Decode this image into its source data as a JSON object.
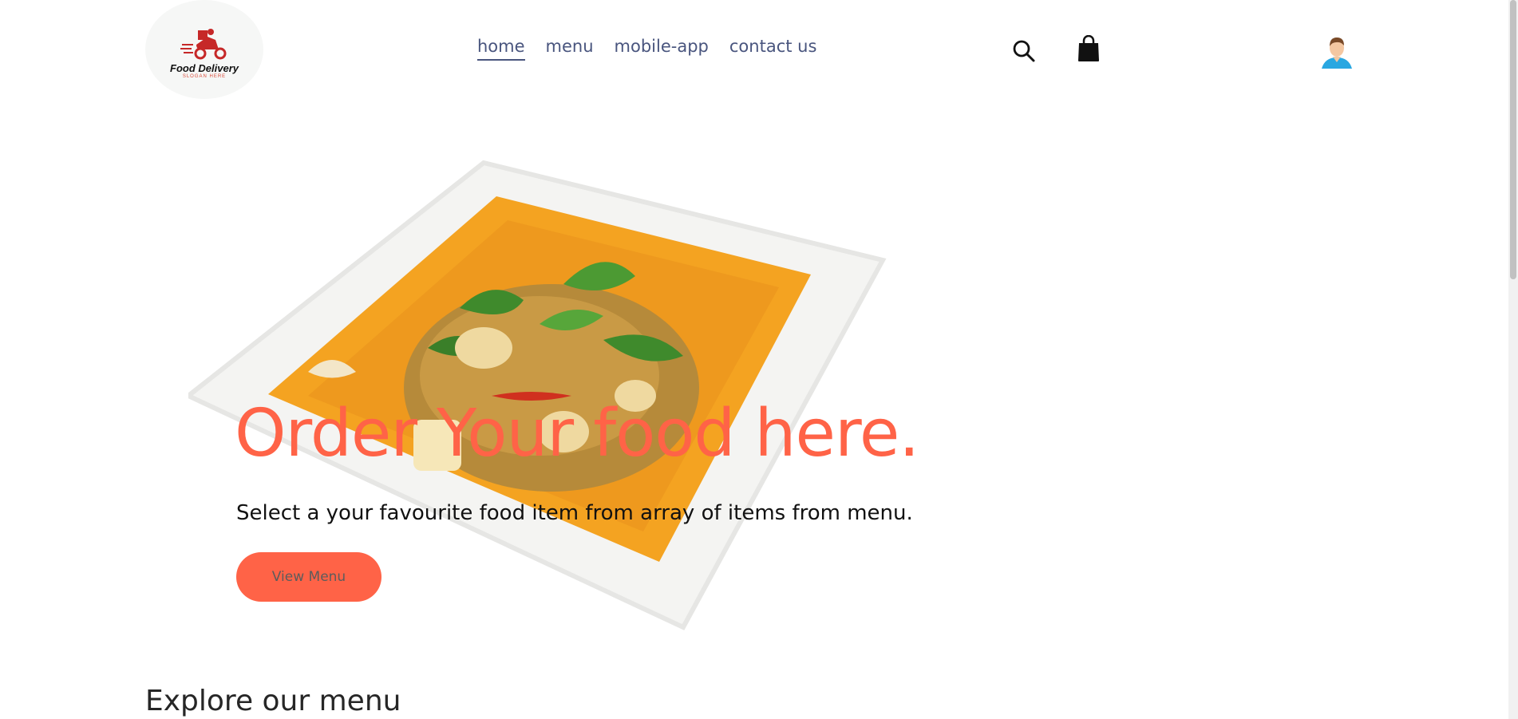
{
  "brand": {
    "title": "Food Delivery",
    "slogan": "SLOGAN HERE"
  },
  "nav": {
    "items": [
      {
        "label": "home",
        "active": true
      },
      {
        "label": "menu",
        "active": false
      },
      {
        "label": "mobile-app",
        "active": false
      },
      {
        "label": "contact us",
        "active": false
      }
    ]
  },
  "icons": {
    "search": "search-icon",
    "bag": "shopping-bag-icon",
    "profile": "profile-avatar-icon"
  },
  "hero": {
    "title": "Order Your food here.",
    "subtitle": "Select a your favourite food item from array of items from menu.",
    "button_label": "View Menu"
  },
  "explore": {
    "title": "Explore our menu"
  },
  "colors": {
    "accent": "#ff6347",
    "nav_text": "#49557e"
  }
}
